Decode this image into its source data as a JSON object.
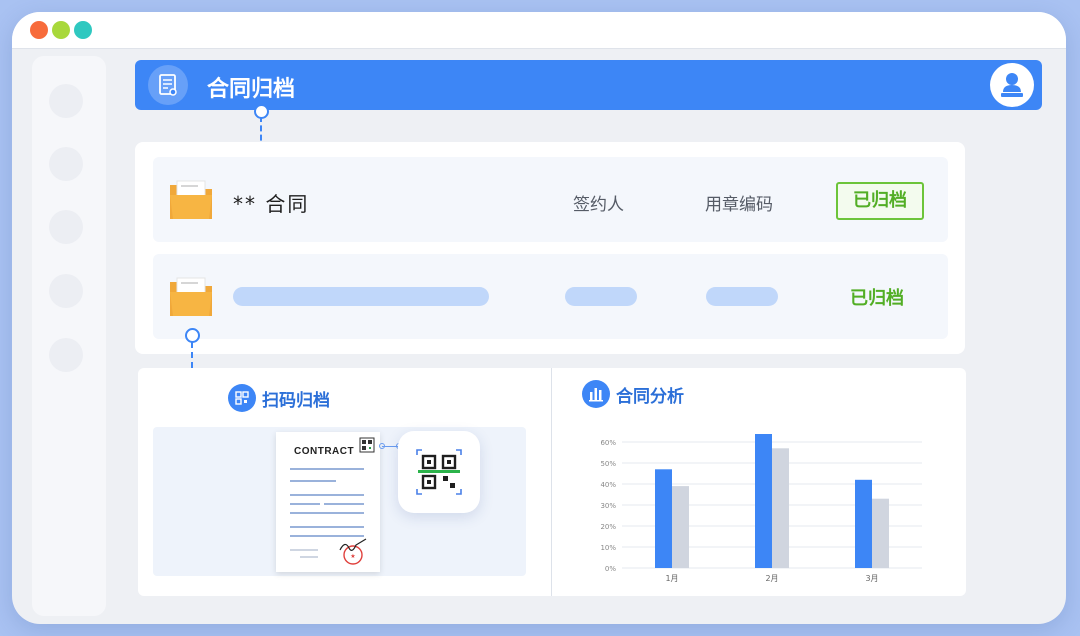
{
  "window": {
    "controls": [
      "close",
      "minimize",
      "maximize"
    ]
  },
  "header": {
    "title": "合同归档",
    "icon": "contract-doc-icon",
    "avatar_icon": "user-avatar-icon",
    "bar_color": "#3d86f6"
  },
  "contracts": {
    "rows": [
      {
        "title": "** 合同",
        "signer": "签约人",
        "seal_code": "用章编码",
        "status": "已归档",
        "status_style": "boxed",
        "icon": "folder-icon"
      },
      {
        "title": "",
        "signer": "",
        "seal_code": "",
        "status": "已归档",
        "status_style": "plain",
        "icon": "folder-icon",
        "placeholder": true
      }
    ],
    "status_color": "#52ae25"
  },
  "scan": {
    "title": "扫码归档",
    "icon": "qr-scan-icon",
    "document_heading": "CONTRACT",
    "document_icons": [
      "doc-qr-icon",
      "signature-icon",
      "seal-stamp-icon"
    ],
    "scanner_icon": "qr-scanner-icon"
  },
  "analysis": {
    "title": "合同分析",
    "icon": "bar-chart-icon"
  },
  "chart_data": {
    "type": "bar",
    "categories": [
      "1月",
      "2月",
      "3月"
    ],
    "series": [
      {
        "values": [
          47,
          65,
          42
        ],
        "color": "#3d86f6"
      },
      {
        "values": [
          39,
          57,
          33
        ],
        "color": "#d0d5df"
      }
    ],
    "ylim": [
      0,
      60
    ],
    "yticks": [
      "0%",
      "10%",
      "20%",
      "30%",
      "40%",
      "50%",
      "60%"
    ],
    "grid": true
  }
}
